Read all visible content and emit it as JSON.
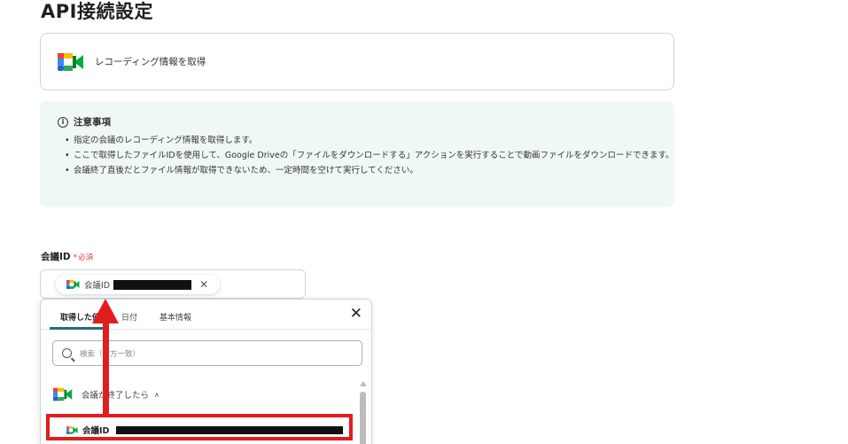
{
  "page": {
    "title": "API接続設定"
  },
  "action": {
    "label": "レコーディング情報を取得",
    "icon": "google-meet-icon"
  },
  "notice": {
    "heading": "注意事項",
    "items": [
      "指定の会議のレコーディング情報を取得します。",
      "ここで取得したファイルIDを使用して、Google Driveの「ファイルをダウンロードする」アクションを実行することで動画ファイルをダウンロードできます。",
      "会議終了直後だとファイル情報が取得できないため、一定時間を空けて実行してください。"
    ]
  },
  "field": {
    "label": "会議ID",
    "required_mark": "*",
    "required_text": "必須",
    "chip_label": "会議ID"
  },
  "dropdown": {
    "tabs": [
      "取得した値",
      "日付",
      "基本情報"
    ],
    "active_tab": "取得した値",
    "search_placeholder": "検索（前方一致）",
    "group_label": "会議が終了したら",
    "option_label": "会議ID"
  },
  "colors": {
    "accent": "#1f6f73",
    "required": "#e0403c",
    "annotation": "#e01e1e",
    "notice_bg": "#f0f8f7"
  }
}
